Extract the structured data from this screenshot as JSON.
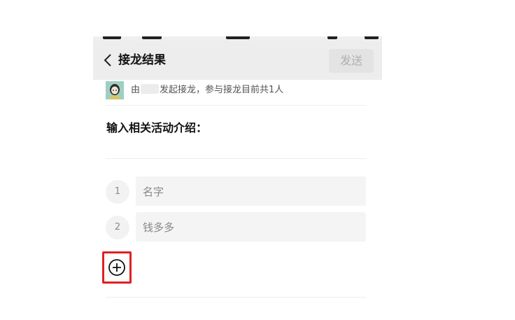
{
  "navbar": {
    "title": "接龙结果",
    "send_label": "发送"
  },
  "info": {
    "prefix": "由",
    "suffix": "发起接龙，参与接龙目前共1人"
  },
  "intro_label": "输入相关活动介绍：",
  "entries": [
    {
      "number": "1",
      "value": "名字"
    },
    {
      "number": "2",
      "value": "钱多多"
    }
  ],
  "colors": {
    "highlight": "#e02020",
    "navbar_bg": "#ededed",
    "send_disabled_text": "#b0b0b0"
  },
  "icons": {
    "back": "chevron-left-icon",
    "add": "plus-circle-icon"
  }
}
